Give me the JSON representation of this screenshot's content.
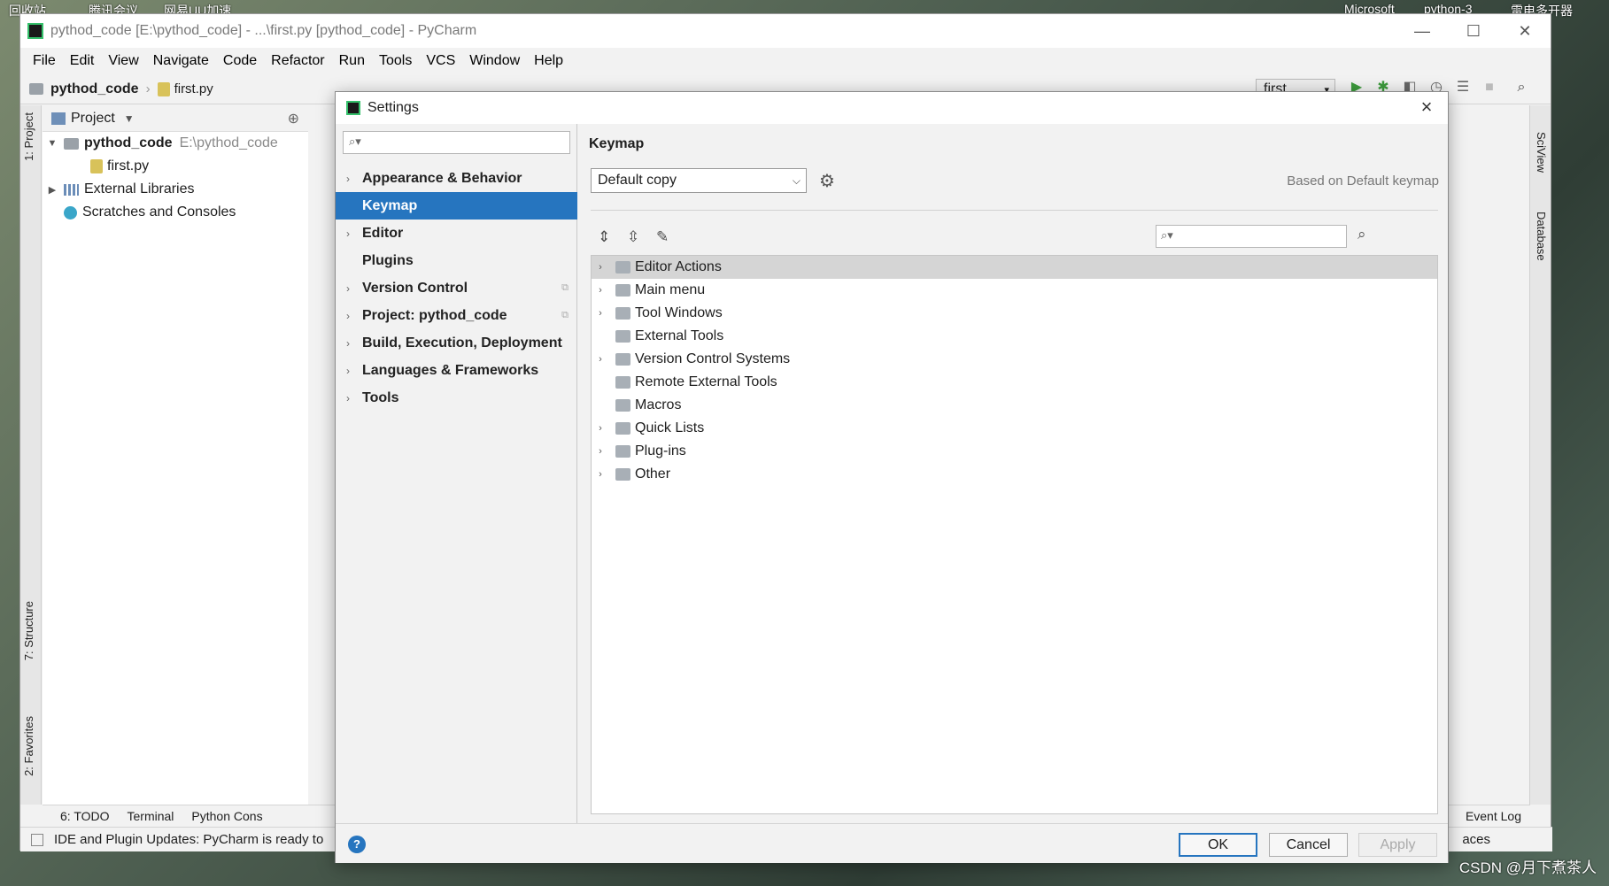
{
  "window": {
    "title": "pythod_code [E:\\pythod_code] - ...\\first.py [pythod_code] - PyCharm",
    "minimize": "—",
    "maximize": "☐",
    "close": "✕"
  },
  "desktop": {
    "labels": [
      "回收站",
      "腾讯会议",
      "网易UU加速",
      "Microsoft",
      "python-3",
      "雷电多开器"
    ]
  },
  "menu": [
    "File",
    "Edit",
    "View",
    "Navigate",
    "Code",
    "Refactor",
    "Run",
    "Tools",
    "VCS",
    "Window",
    "Help"
  ],
  "navbar": {
    "project": "pythod_code",
    "file": "first.py",
    "run_config": "first"
  },
  "project_panel": {
    "title": "Project",
    "root_name": "pythod_code",
    "root_path": "E:\\pythod_code",
    "file": "first.py",
    "external_libraries": "External Libraries",
    "scratches": "Scratches and Consoles"
  },
  "left_tabs": {
    "project": "1: Project",
    "structure": "7: Structure",
    "favorites": "2: Favorites"
  },
  "right_tabs": {
    "sciview": "SciView",
    "database": "Database"
  },
  "bottom_tools": {
    "todo": "6: TODO",
    "terminal": "Terminal",
    "python_console": "Python Cons",
    "event_log": "Event Log"
  },
  "status": {
    "message": "IDE and Plugin Updates: PyCharm is ready to",
    "indent": "aces"
  },
  "settings": {
    "title": "Settings",
    "nav": [
      {
        "label": "Appearance & Behavior",
        "expandable": true,
        "selected": false
      },
      {
        "label": "Keymap",
        "expandable": false,
        "selected": true
      },
      {
        "label": "Editor",
        "expandable": true,
        "selected": false
      },
      {
        "label": "Plugins",
        "expandable": false,
        "selected": false
      },
      {
        "label": "Version Control",
        "expandable": true,
        "selected": false
      },
      {
        "label": "Project: pythod_code",
        "expandable": true,
        "selected": false
      },
      {
        "label": "Build, Execution, Deployment",
        "expandable": true,
        "selected": false
      },
      {
        "label": "Languages & Frameworks",
        "expandable": true,
        "selected": false
      },
      {
        "label": "Tools",
        "expandable": true,
        "selected": false
      }
    ],
    "keymap": {
      "heading": "Keymap",
      "selected": "Default copy",
      "based_on": "Based on Default keymap",
      "tree": [
        {
          "label": "Editor Actions",
          "expandable": true
        },
        {
          "label": "Main menu",
          "expandable": true
        },
        {
          "label": "Tool Windows",
          "expandable": true
        },
        {
          "label": "External Tools",
          "expandable": false
        },
        {
          "label": "Version Control Systems",
          "expandable": true
        },
        {
          "label": "Remote External Tools",
          "expandable": false
        },
        {
          "label": "Macros",
          "expandable": false
        },
        {
          "label": "Quick Lists",
          "expandable": true
        },
        {
          "label": "Plug-ins",
          "expandable": true
        },
        {
          "label": "Other",
          "expandable": true
        }
      ]
    },
    "buttons": {
      "ok": "OK",
      "cancel": "Cancel",
      "apply": "Apply",
      "help": "?"
    }
  },
  "watermark": "CSDN @月下煮茶人",
  "colors": {
    "accent": "#2675bf",
    "selection_gray": "#d5d5d5"
  }
}
